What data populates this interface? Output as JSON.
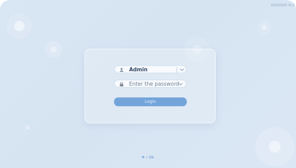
{
  "header": {
    "timestamp": "2024/03/02 01:2"
  },
  "login_form": {
    "username": {
      "value": "Admin",
      "icon": "user-icon"
    },
    "password": {
      "placeholder": "Enter the password",
      "icon": "lock-icon"
    },
    "dropdown_icon": "chevron-down-icon",
    "button_label": "Login"
  },
  "footer": {
    "language_cn": "中",
    "language_separator": "/",
    "language_en": "EN"
  },
  "colors": {
    "background": "#d8e6f4",
    "button": "#72a4da",
    "accent_text": "#4a86c8"
  }
}
